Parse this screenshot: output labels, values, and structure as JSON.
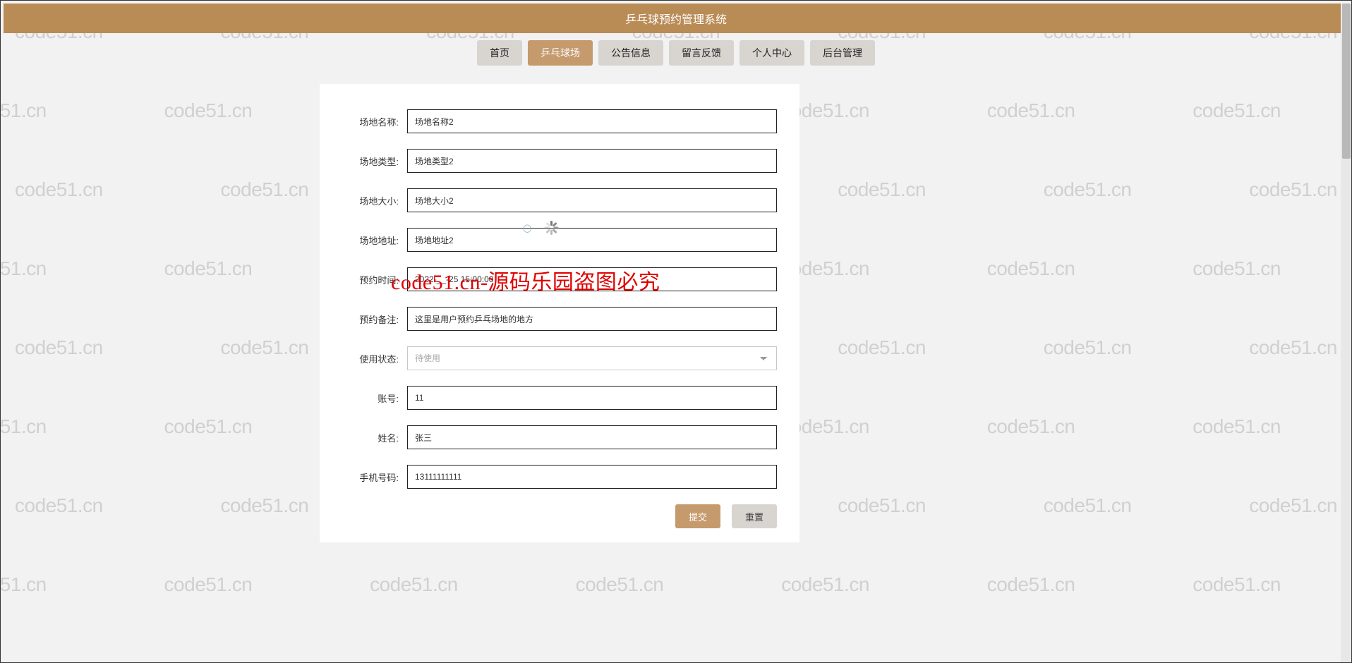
{
  "header": {
    "title": "乒乓球预约管理系统"
  },
  "nav": {
    "items": [
      {
        "label": "首页",
        "active": false
      },
      {
        "label": "乒乓球场",
        "active": true
      },
      {
        "label": "公告信息",
        "active": false
      },
      {
        "label": "留言反馈",
        "active": false
      },
      {
        "label": "个人中心",
        "active": false
      },
      {
        "label": "后台管理",
        "active": false
      }
    ]
  },
  "form": {
    "fields": {
      "venue_name": {
        "label": "场地名称:",
        "value": "场地名称2"
      },
      "venue_type": {
        "label": "场地类型:",
        "value": "场地类型2"
      },
      "venue_size": {
        "label": "场地大小:",
        "value": "场地大小2"
      },
      "venue_addr": {
        "label": "场地地址:",
        "value": "场地地址2"
      },
      "reserve_time": {
        "label": "预约时间:",
        "value": "2022-__-25 15:00:00"
      },
      "reserve_note": {
        "label": "预约备注:",
        "value": "这里是用户预约乒乓场地的地方"
      },
      "use_status": {
        "label": "使用状态:",
        "value": "待使用"
      },
      "account": {
        "label": "账号:",
        "value": "11"
      },
      "name": {
        "label": "姓名:",
        "value": "张三"
      },
      "phone": {
        "label": "手机号码:",
        "value": "13111111111"
      }
    },
    "buttons": {
      "submit": "提交",
      "reset": "重置"
    }
  },
  "watermark": {
    "text": "code51.cn"
  },
  "overlay": {
    "text": "code51.cn-源码乐园盗图必究"
  }
}
